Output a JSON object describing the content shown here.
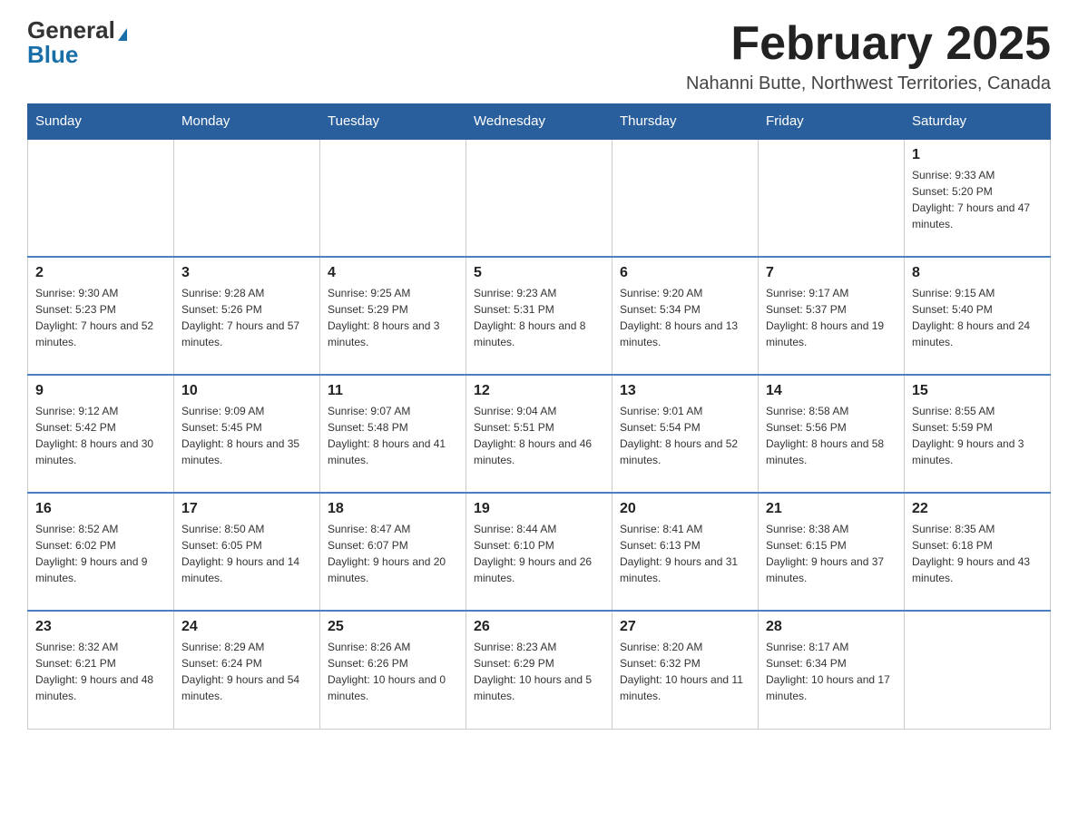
{
  "logo": {
    "general": "General",
    "blue": "Blue"
  },
  "header": {
    "title": "February 2025",
    "subtitle": "Nahanni Butte, Northwest Territories, Canada"
  },
  "weekdays": [
    "Sunday",
    "Monday",
    "Tuesday",
    "Wednesday",
    "Thursday",
    "Friday",
    "Saturday"
  ],
  "weeks": [
    [
      {
        "day": "",
        "info": ""
      },
      {
        "day": "",
        "info": ""
      },
      {
        "day": "",
        "info": ""
      },
      {
        "day": "",
        "info": ""
      },
      {
        "day": "",
        "info": ""
      },
      {
        "day": "",
        "info": ""
      },
      {
        "day": "1",
        "info": "Sunrise: 9:33 AM\nSunset: 5:20 PM\nDaylight: 7 hours and 47 minutes."
      }
    ],
    [
      {
        "day": "2",
        "info": "Sunrise: 9:30 AM\nSunset: 5:23 PM\nDaylight: 7 hours and 52 minutes."
      },
      {
        "day": "3",
        "info": "Sunrise: 9:28 AM\nSunset: 5:26 PM\nDaylight: 7 hours and 57 minutes."
      },
      {
        "day": "4",
        "info": "Sunrise: 9:25 AM\nSunset: 5:29 PM\nDaylight: 8 hours and 3 minutes."
      },
      {
        "day": "5",
        "info": "Sunrise: 9:23 AM\nSunset: 5:31 PM\nDaylight: 8 hours and 8 minutes."
      },
      {
        "day": "6",
        "info": "Sunrise: 9:20 AM\nSunset: 5:34 PM\nDaylight: 8 hours and 13 minutes."
      },
      {
        "day": "7",
        "info": "Sunrise: 9:17 AM\nSunset: 5:37 PM\nDaylight: 8 hours and 19 minutes."
      },
      {
        "day": "8",
        "info": "Sunrise: 9:15 AM\nSunset: 5:40 PM\nDaylight: 8 hours and 24 minutes."
      }
    ],
    [
      {
        "day": "9",
        "info": "Sunrise: 9:12 AM\nSunset: 5:42 PM\nDaylight: 8 hours and 30 minutes."
      },
      {
        "day": "10",
        "info": "Sunrise: 9:09 AM\nSunset: 5:45 PM\nDaylight: 8 hours and 35 minutes."
      },
      {
        "day": "11",
        "info": "Sunrise: 9:07 AM\nSunset: 5:48 PM\nDaylight: 8 hours and 41 minutes."
      },
      {
        "day": "12",
        "info": "Sunrise: 9:04 AM\nSunset: 5:51 PM\nDaylight: 8 hours and 46 minutes."
      },
      {
        "day": "13",
        "info": "Sunrise: 9:01 AM\nSunset: 5:54 PM\nDaylight: 8 hours and 52 minutes."
      },
      {
        "day": "14",
        "info": "Sunrise: 8:58 AM\nSunset: 5:56 PM\nDaylight: 8 hours and 58 minutes."
      },
      {
        "day": "15",
        "info": "Sunrise: 8:55 AM\nSunset: 5:59 PM\nDaylight: 9 hours and 3 minutes."
      }
    ],
    [
      {
        "day": "16",
        "info": "Sunrise: 8:52 AM\nSunset: 6:02 PM\nDaylight: 9 hours and 9 minutes."
      },
      {
        "day": "17",
        "info": "Sunrise: 8:50 AM\nSunset: 6:05 PM\nDaylight: 9 hours and 14 minutes."
      },
      {
        "day": "18",
        "info": "Sunrise: 8:47 AM\nSunset: 6:07 PM\nDaylight: 9 hours and 20 minutes."
      },
      {
        "day": "19",
        "info": "Sunrise: 8:44 AM\nSunset: 6:10 PM\nDaylight: 9 hours and 26 minutes."
      },
      {
        "day": "20",
        "info": "Sunrise: 8:41 AM\nSunset: 6:13 PM\nDaylight: 9 hours and 31 minutes."
      },
      {
        "day": "21",
        "info": "Sunrise: 8:38 AM\nSunset: 6:15 PM\nDaylight: 9 hours and 37 minutes."
      },
      {
        "day": "22",
        "info": "Sunrise: 8:35 AM\nSunset: 6:18 PM\nDaylight: 9 hours and 43 minutes."
      }
    ],
    [
      {
        "day": "23",
        "info": "Sunrise: 8:32 AM\nSunset: 6:21 PM\nDaylight: 9 hours and 48 minutes."
      },
      {
        "day": "24",
        "info": "Sunrise: 8:29 AM\nSunset: 6:24 PM\nDaylight: 9 hours and 54 minutes."
      },
      {
        "day": "25",
        "info": "Sunrise: 8:26 AM\nSunset: 6:26 PM\nDaylight: 10 hours and 0 minutes."
      },
      {
        "day": "26",
        "info": "Sunrise: 8:23 AM\nSunset: 6:29 PM\nDaylight: 10 hours and 5 minutes."
      },
      {
        "day": "27",
        "info": "Sunrise: 8:20 AM\nSunset: 6:32 PM\nDaylight: 10 hours and 11 minutes."
      },
      {
        "day": "28",
        "info": "Sunrise: 8:17 AM\nSunset: 6:34 PM\nDaylight: 10 hours and 17 minutes."
      },
      {
        "day": "",
        "info": ""
      }
    ]
  ]
}
